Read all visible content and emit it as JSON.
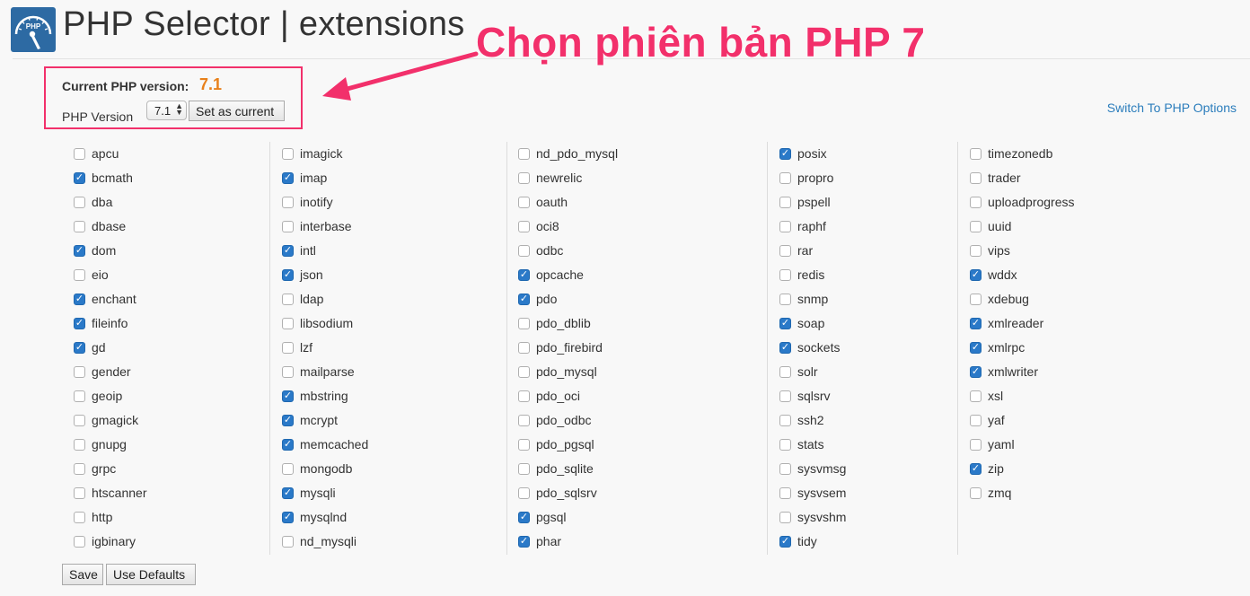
{
  "header": {
    "title": "PHP Selector | extensions",
    "logo_text": "PHP"
  },
  "annotation": {
    "text": "Chọn phiên bản PHP 7",
    "color": "#f2306b"
  },
  "version_panel": {
    "current_label": "Current PHP version:",
    "current_value": "7.1",
    "php_version_label": "PHP Version",
    "selected_version": "7.1",
    "set_current_button": "Set as current"
  },
  "switch_link": "Switch To PHP Options",
  "extension_columns": [
    [
      {
        "name": "apcu",
        "checked": false
      },
      {
        "name": "bcmath",
        "checked": true
      },
      {
        "name": "dba",
        "checked": false
      },
      {
        "name": "dbase",
        "checked": false
      },
      {
        "name": "dom",
        "checked": true
      },
      {
        "name": "eio",
        "checked": false
      },
      {
        "name": "enchant",
        "checked": true
      },
      {
        "name": "fileinfo",
        "checked": true
      },
      {
        "name": "gd",
        "checked": true
      },
      {
        "name": "gender",
        "checked": false
      },
      {
        "name": "geoip",
        "checked": false
      },
      {
        "name": "gmagick",
        "checked": false
      },
      {
        "name": "gnupg",
        "checked": false
      },
      {
        "name": "grpc",
        "checked": false
      },
      {
        "name": "htscanner",
        "checked": false
      },
      {
        "name": "http",
        "checked": false
      },
      {
        "name": "igbinary",
        "checked": false
      }
    ],
    [
      {
        "name": "imagick",
        "checked": false
      },
      {
        "name": "imap",
        "checked": true
      },
      {
        "name": "inotify",
        "checked": false
      },
      {
        "name": "interbase",
        "checked": false
      },
      {
        "name": "intl",
        "checked": true
      },
      {
        "name": "json",
        "checked": true
      },
      {
        "name": "ldap",
        "checked": false
      },
      {
        "name": "libsodium",
        "checked": false
      },
      {
        "name": "lzf",
        "checked": false
      },
      {
        "name": "mailparse",
        "checked": false
      },
      {
        "name": "mbstring",
        "checked": true
      },
      {
        "name": "mcrypt",
        "checked": true
      },
      {
        "name": "memcached",
        "checked": true
      },
      {
        "name": "mongodb",
        "checked": false
      },
      {
        "name": "mysqli",
        "checked": true
      },
      {
        "name": "mysqlnd",
        "checked": true
      },
      {
        "name": "nd_mysqli",
        "checked": false
      }
    ],
    [
      {
        "name": "nd_pdo_mysql",
        "checked": false
      },
      {
        "name": "newrelic",
        "checked": false
      },
      {
        "name": "oauth",
        "checked": false
      },
      {
        "name": "oci8",
        "checked": false
      },
      {
        "name": "odbc",
        "checked": false
      },
      {
        "name": "opcache",
        "checked": true
      },
      {
        "name": "pdo",
        "checked": true
      },
      {
        "name": "pdo_dblib",
        "checked": false
      },
      {
        "name": "pdo_firebird",
        "checked": false
      },
      {
        "name": "pdo_mysql",
        "checked": false
      },
      {
        "name": "pdo_oci",
        "checked": false
      },
      {
        "name": "pdo_odbc",
        "checked": false
      },
      {
        "name": "pdo_pgsql",
        "checked": false
      },
      {
        "name": "pdo_sqlite",
        "checked": false
      },
      {
        "name": "pdo_sqlsrv",
        "checked": false
      },
      {
        "name": "pgsql",
        "checked": true
      },
      {
        "name": "phar",
        "checked": true
      }
    ],
    [
      {
        "name": "posix",
        "checked": true
      },
      {
        "name": "propro",
        "checked": false
      },
      {
        "name": "pspell",
        "checked": false
      },
      {
        "name": "raphf",
        "checked": false
      },
      {
        "name": "rar",
        "checked": false
      },
      {
        "name": "redis",
        "checked": false
      },
      {
        "name": "snmp",
        "checked": false
      },
      {
        "name": "soap",
        "checked": true
      },
      {
        "name": "sockets",
        "checked": true
      },
      {
        "name": "solr",
        "checked": false
      },
      {
        "name": "sqlsrv",
        "checked": false
      },
      {
        "name": "ssh2",
        "checked": false
      },
      {
        "name": "stats",
        "checked": false
      },
      {
        "name": "sysvmsg",
        "checked": false
      },
      {
        "name": "sysvsem",
        "checked": false
      },
      {
        "name": "sysvshm",
        "checked": false
      },
      {
        "name": "tidy",
        "checked": true
      }
    ],
    [
      {
        "name": "timezonedb",
        "checked": false
      },
      {
        "name": "trader",
        "checked": false
      },
      {
        "name": "uploadprogress",
        "checked": false
      },
      {
        "name": "uuid",
        "checked": false
      },
      {
        "name": "vips",
        "checked": false
      },
      {
        "name": "wddx",
        "checked": true
      },
      {
        "name": "xdebug",
        "checked": false
      },
      {
        "name": "xmlreader",
        "checked": true
      },
      {
        "name": "xmlrpc",
        "checked": true
      },
      {
        "name": "xmlwriter",
        "checked": true
      },
      {
        "name": "xsl",
        "checked": false
      },
      {
        "name": "yaf",
        "checked": false
      },
      {
        "name": "yaml",
        "checked": false
      },
      {
        "name": "zip",
        "checked": true
      },
      {
        "name": "zmq",
        "checked": false
      }
    ]
  ],
  "footer": {
    "save_label": "Save",
    "defaults_label": "Use Defaults"
  },
  "colors": {
    "accent_link": "#2b7dbc",
    "version_value": "#e8801a",
    "checkbox_checked": "#2a79c8"
  },
  "icons": {
    "logo": "php-selector-gauge-icon",
    "checkbox_mark": "checkmark-icon"
  }
}
